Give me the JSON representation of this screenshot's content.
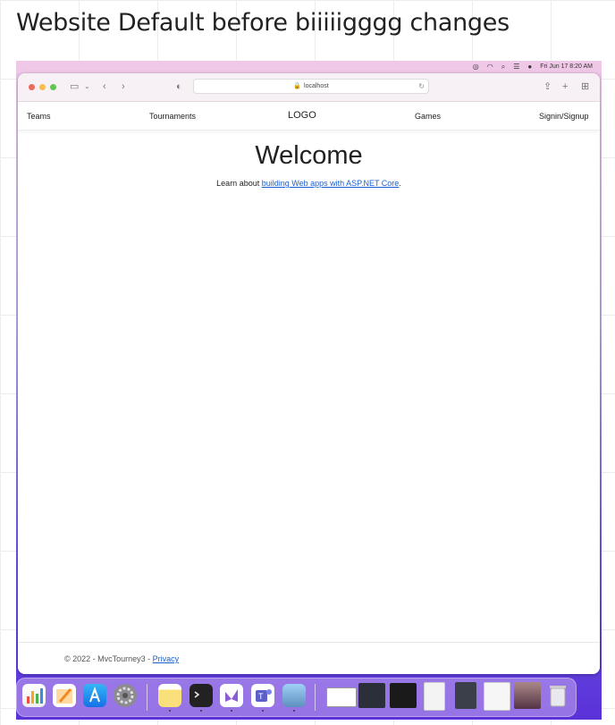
{
  "board": {
    "title": "Website Default before biiiiigggg changes"
  },
  "menubar": {
    "icons": [
      "creative-cloud-icon",
      "wifi-icon",
      "search-icon",
      "control-center-icon",
      "siri-icon"
    ],
    "datetime": "Fri Jun 17  8:20 AM"
  },
  "browser": {
    "address": "localhost"
  },
  "site": {
    "nav": {
      "teams": "Teams",
      "tournaments": "Tournaments",
      "logo": "LOGO",
      "games": "Games",
      "signin": "Signin/Signup"
    },
    "heading": "Welcome",
    "learn_prefix": "Learn about ",
    "learn_link": "building Web apps with ASP.NET Core",
    "learn_suffix": ".",
    "footer_text": "© 2022 - MvcTourney3 - ",
    "footer_link": "Privacy"
  },
  "dock": {
    "apps": [
      "numbers-icon",
      "pages-icon",
      "app-store-icon",
      "system-preferences-icon",
      "notes-icon",
      "terminal-icon",
      "visual-studio-icon",
      "teams-icon",
      "preview-icon"
    ],
    "minimized": [
      "window-thumbnail-1",
      "window-thumbnail-2",
      "window-thumbnail-3",
      "window-thumbnail-4",
      "window-thumbnail-5",
      "window-thumbnail-6",
      "window-thumbnail-7"
    ],
    "trash": "trash-icon"
  }
}
